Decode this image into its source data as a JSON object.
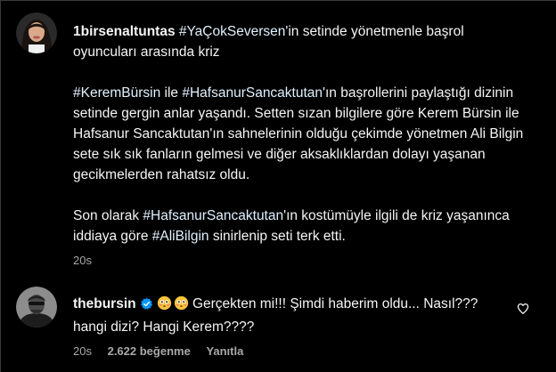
{
  "post": {
    "username": "1birsenaltuntas",
    "line1_hashtag": "#YaÇokSeversen",
    "line1_rest": "'in setinde yönetmenle başrol oyuncuları arasında kriz",
    "p2_hashtag1": "#KeremBürsin",
    "p2_text1": " ile ",
    "p2_hashtag2": "#HafsanurSancaktutan",
    "p2_text2": "'ın başrollerini paylaştığı dizinin setinde gergin anlar yaşandı. Setten sızan bilgilere göre Kerem Bürsin ile Hafsanur Sancaktutan'ın sahnelerinin olduğu çekimde yönetmen Ali Bilgin sete sık sık fanların gelmesi ve diğer aksaklıklardan dolayı yaşanan gecikmelerden rahatsız oldu.",
    "p3_text1": "Son olarak ",
    "p3_hashtag1": "#HafsanurSancaktutan",
    "p3_text2": "'ın kostümüyle ilgili de kriz yaşanınca iddiaya göre ",
    "p3_hashtag2": "#AliBilgin",
    "p3_text3": " sinirlenip seti terk etti.",
    "time": "20s"
  },
  "comment": {
    "username": "thebursin",
    "text": "Gerçekten mi!!! Şimdi haberim oldu... Nasıl??? hangi dizi? Hangi Kerem????",
    "time": "20s",
    "likes": "2.622 beğenme",
    "reply_label": "Yanıtla",
    "icons": {
      "verified": "verified-badge-icon",
      "emoji": "flushed-face-emoji",
      "like": "heart-icon"
    }
  },
  "colors": {
    "background": "#000000",
    "text": "#f5f5f5",
    "hashtag": "#e0f1ff",
    "muted": "#a8a8a8",
    "verified": "#0095f6"
  }
}
